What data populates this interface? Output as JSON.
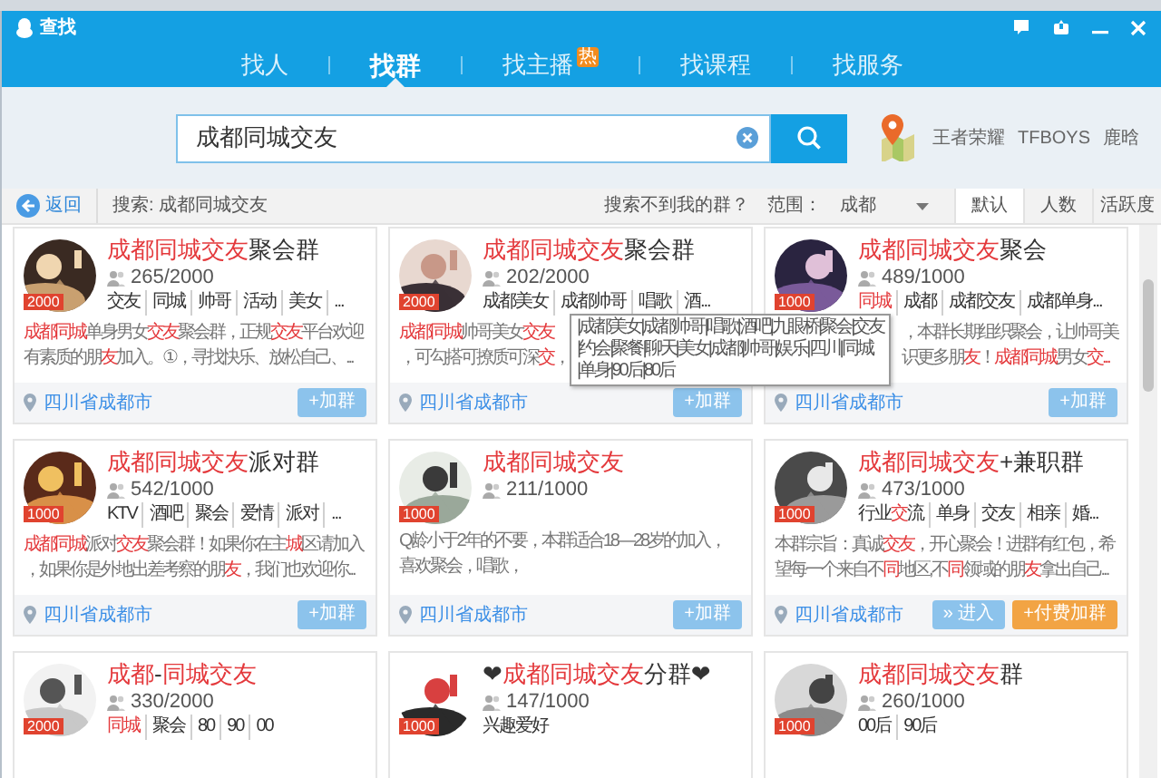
{
  "window": {
    "title": "查找"
  },
  "tabs": [
    {
      "label": "找人",
      "selected": false
    },
    {
      "label": "找群",
      "selected": true
    },
    {
      "label": "找主播",
      "selected": false,
      "badge": "热"
    },
    {
      "label": "找课程",
      "selected": false
    },
    {
      "label": "找服务",
      "selected": false
    }
  ],
  "search": {
    "value": "成都同城交友"
  },
  "hot_words": [
    "王者荣耀",
    "TFBOYS",
    "鹿晗"
  ],
  "filter_bar": {
    "back": "返回",
    "query": "搜索: 成都同城交友",
    "not_found": "搜索不到我的群？",
    "scope_label": "范围：",
    "scope": "成都",
    "sort_tabs": [
      {
        "label": "默认",
        "selected": true
      },
      {
        "label": "人数",
        "selected": false
      },
      {
        "label": "活跃度",
        "selected": false
      }
    ]
  },
  "groups": [
    {
      "title": [
        {
          "text": "成都同城交友",
          "hit": true
        },
        {
          "text": "聚会群",
          "hit": false
        }
      ],
      "badge": "2000",
      "members": "265/2000",
      "tags": [
        [
          {
            "text": "交友",
            "hit": false
          }
        ],
        [
          {
            "text": "同城",
            "hit": false
          }
        ],
        [
          {
            "text": "帅哥",
            "hit": false
          }
        ],
        [
          {
            "text": "活动",
            "hit": false
          }
        ],
        [
          {
            "text": "美女",
            "hit": false
          }
        ],
        [
          {
            "text": "...",
            "hit": false
          }
        ]
      ],
      "description": [
        [
          {
            "text": "成都同城",
            "hit": true
          },
          {
            "text": "单身男女",
            "hit": false
          },
          {
            "text": "交友",
            "hit": true
          },
          {
            "text": "聚会群，正规",
            "hit": false
          },
          {
            "text": "交友",
            "hit": true
          },
          {
            "text": "平台欢迎",
            "hit": false
          }
        ],
        [
          {
            "text": "有素质的朋",
            "hit": false
          },
          {
            "text": "友",
            "hit": true
          },
          {
            "text": "加入。①，寻找快乐、放松自己、...",
            "hit": false
          }
        ]
      ],
      "location": "四川省成都市",
      "buttons": [
        {
          "kind": "join",
          "label": "+加群"
        }
      ]
    },
    {
      "title": [
        {
          "text": "成都同城交友",
          "hit": true
        },
        {
          "text": "聚会群",
          "hit": false
        }
      ],
      "badge": "2000",
      "members": "202/2000",
      "tags": [
        [
          {
            "text": "成都美女",
            "hit": false
          }
        ],
        [
          {
            "text": "成都帅哥",
            "hit": false
          }
        ],
        [
          {
            "text": "唱歌",
            "hit": false
          }
        ],
        [
          {
            "text": "酒...",
            "hit": false
          }
        ]
      ],
      "description": [
        [
          {
            "text": "成都同城",
            "hit": true
          },
          {
            "text": "帅哥美女",
            "hit": false
          },
          {
            "text": "交友",
            "hit": true
          }
        ],
        [
          {
            "text": "，可勾搭可撩质可深",
            "hit": false
          },
          {
            "text": "交",
            "hit": true
          },
          {
            "text": "，",
            "hit": false
          }
        ]
      ],
      "tooltip": [
        "|成都美女|成都帅哥|唱歌|酒吧|九眼桥|聚会|交友",
        "|约会|聚餐|聊天|美女|成都|帅哥|娱乐|四川|同城",
        "|单身|90后|80后"
      ],
      "location": "四川省成都市",
      "buttons": [
        {
          "kind": "join",
          "label": "+加群"
        }
      ]
    },
    {
      "title": [
        {
          "text": "成都同城交友",
          "hit": true
        },
        {
          "text": "聚会",
          "hit": false
        }
      ],
      "badge": "1000",
      "members": "489/1000",
      "tags": [
        [
          {
            "text": "同城",
            "hit": true
          }
        ],
        [
          {
            "text": "成都",
            "hit": false
          }
        ],
        [
          {
            "text": "成都交友",
            "hit": false
          }
        ],
        [
          {
            "text": "成都单身...",
            "hit": false
          }
        ]
      ],
      "description": [
        [
          {
            "text": "，本群长期组织聚会，让帅哥美",
            "hit": false
          }
        ],
        [
          {
            "text": "识更多朋",
            "hit": false
          },
          {
            "text": "友",
            "hit": true
          },
          {
            "text": "！",
            "hit": false
          },
          {
            "text": "成都同城",
            "hit": true
          },
          {
            "text": "男女",
            "hit": false
          },
          {
            "text": "交...",
            "hit": true
          }
        ]
      ],
      "location": "四川省成都市",
      "buttons": [
        {
          "kind": "join",
          "label": "+加群"
        }
      ]
    },
    {
      "title": [
        {
          "text": "成都同城交友",
          "hit": true
        },
        {
          "text": "派对群",
          "hit": false
        }
      ],
      "badge": "1000",
      "members": "542/1000",
      "tags": [
        [
          {
            "text": "KTV",
            "hit": false
          }
        ],
        [
          {
            "text": "酒吧",
            "hit": false
          }
        ],
        [
          {
            "text": "聚会",
            "hit": false
          }
        ],
        [
          {
            "text": "爱情",
            "hit": false
          }
        ],
        [
          {
            "text": "派对",
            "hit": false
          }
        ],
        [
          {
            "text": "...",
            "hit": false
          }
        ]
      ],
      "description": [
        [
          {
            "text": "成都同城",
            "hit": true
          },
          {
            "text": "派对",
            "hit": false
          },
          {
            "text": "交友",
            "hit": true
          },
          {
            "text": "聚会群！如果你在主",
            "hit": false
          },
          {
            "text": "城",
            "hit": true
          },
          {
            "text": "区请加入",
            "hit": false
          }
        ],
        [
          {
            "text": "，如果你是外地出差考察的朋",
            "hit": false
          },
          {
            "text": "友",
            "hit": true
          },
          {
            "text": "，我们也欢迎你...",
            "hit": false
          }
        ]
      ],
      "location": "四川省成都市",
      "buttons": [
        {
          "kind": "join",
          "label": "+加群"
        }
      ]
    },
    {
      "title": [
        {
          "text": "成都同城交友",
          "hit": true
        }
      ],
      "badge": "1000",
      "members": "211/1000",
      "description": [
        [
          {
            "text": "Q龄小于2年的不要，本群适合18—28岁的加入，",
            "hit": false
          }
        ],
        [
          {
            "text": "喜欢聚会，唱歌，",
            "hit": false
          }
        ]
      ],
      "location": "四川省成都市",
      "buttons": [
        {
          "kind": "join",
          "label": "+加群"
        }
      ]
    },
    {
      "title": [
        {
          "text": "成都同城交友",
          "hit": true
        },
        {
          "text": "+兼职群",
          "hit": false
        }
      ],
      "badge": "1000",
      "members": "473/1000",
      "tags": [
        [
          {
            "text": "行业",
            "hit": false
          },
          {
            "text": "交",
            "hit": true
          },
          {
            "text": "流",
            "hit": false
          }
        ],
        [
          {
            "text": "单身",
            "hit": false
          }
        ],
        [
          {
            "text": "交友",
            "hit": false
          }
        ],
        [
          {
            "text": "相亲",
            "hit": false
          }
        ],
        [
          {
            "text": "婚...",
            "hit": false
          }
        ]
      ],
      "description": [
        [
          {
            "text": "本群宗旨：真诚",
            "hit": false
          },
          {
            "text": "交友",
            "hit": true
          },
          {
            "text": "，开心聚会！进群有红包，希",
            "hit": false
          }
        ],
        [
          {
            "text": "望每一个来自不",
            "hit": false
          },
          {
            "text": "同",
            "hit": true
          },
          {
            "text": "地区,不",
            "hit": false
          },
          {
            "text": "同",
            "hit": true
          },
          {
            "text": "领域的朋",
            "hit": false
          },
          {
            "text": "友",
            "hit": true
          },
          {
            "text": "拿出自己...",
            "hit": false
          }
        ]
      ],
      "location": "四川省成都市",
      "buttons": [
        {
          "kind": "enter",
          "label": "» 进入"
        },
        {
          "kind": "paid",
          "label": "+付费加群"
        }
      ]
    },
    {
      "title": [
        {
          "text": "成都",
          "hit": true
        },
        {
          "text": "-",
          "hit": false
        },
        {
          "text": "同城交友",
          "hit": true
        }
      ],
      "badge": "2000",
      "members": "330/2000",
      "tags": [
        [
          {
            "text": "同城",
            "hit": true
          }
        ],
        [
          {
            "text": "聚会",
            "hit": false
          }
        ],
        [
          {
            "text": "80",
            "hit": false
          }
        ],
        [
          {
            "text": "90",
            "hit": false
          }
        ],
        [
          {
            "text": "00",
            "hit": false
          }
        ]
      ]
    },
    {
      "title": [
        {
          "text": "❤",
          "hit": false
        },
        {
          "text": "成都同城交友",
          "hit": true
        },
        {
          "text": "分群❤",
          "hit": false
        }
      ],
      "badge": "1000",
      "members": "147/1000",
      "tags": [
        [
          {
            "text": "兴趣爱好",
            "hit": false
          }
        ]
      ]
    },
    {
      "title": [
        {
          "text": "成都同城交友",
          "hit": true
        },
        {
          "text": "群",
          "hit": false
        }
      ],
      "badge": "1000",
      "members": "260/1000",
      "tags": [
        [
          {
            "text": "00后",
            "hit": false
          }
        ],
        [
          {
            "text": "90后",
            "hit": false
          }
        ]
      ]
    }
  ]
}
